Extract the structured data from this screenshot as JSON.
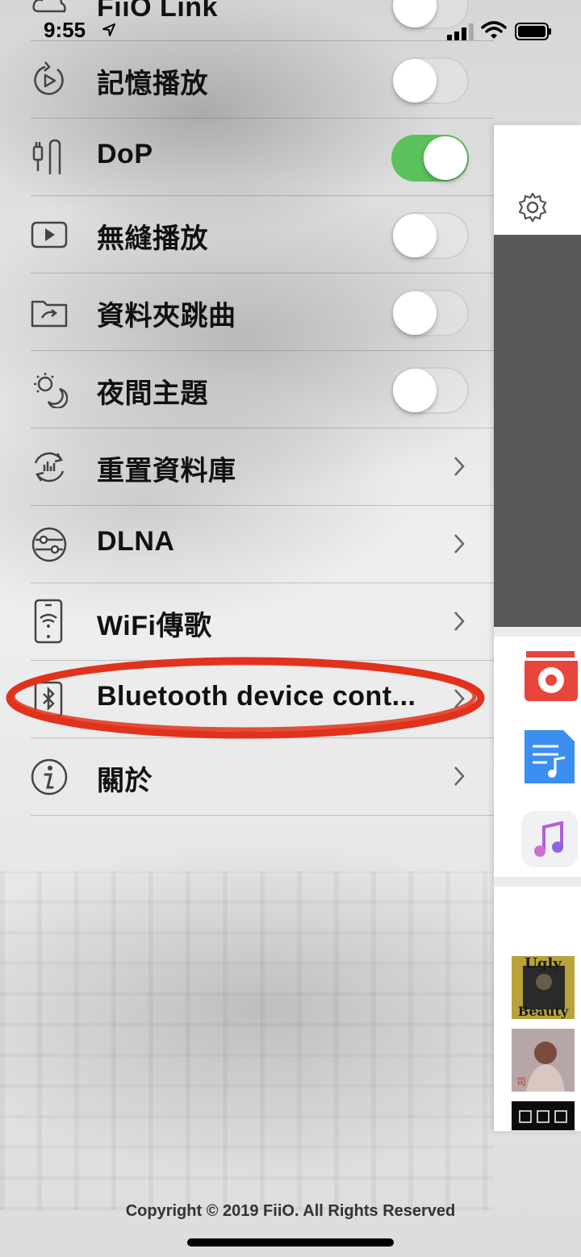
{
  "status_bar": {
    "time": "9:55"
  },
  "partial_row": {
    "label": "FiiO Link",
    "toggle": "off"
  },
  "settings": [
    {
      "label": "記憶播放",
      "control": "toggle",
      "state": "off",
      "icon": "resume-play-icon"
    },
    {
      "label": "DoP",
      "control": "toggle",
      "state": "on",
      "icon": "dop-cable-icon"
    },
    {
      "label": "無縫播放",
      "control": "toggle",
      "state": "off",
      "icon": "gapless-play-icon"
    },
    {
      "label": "資料夾跳曲",
      "control": "toggle",
      "state": "off",
      "icon": "folder-skip-icon"
    },
    {
      "label": "夜間主題",
      "control": "toggle",
      "state": "off",
      "icon": "night-theme-icon"
    },
    {
      "label": "重置資料庫",
      "control": "chevron",
      "icon": "reset-database-icon"
    },
    {
      "label": "DLNA",
      "control": "chevron",
      "icon": "dlna-icon"
    },
    {
      "label": "WiFi傳歌",
      "control": "chevron",
      "icon": "wifi-transfer-icon"
    },
    {
      "label": "Bluetooth device cont...",
      "control": "chevron",
      "icon": "bluetooth-icon",
      "highlighted": true
    },
    {
      "label": "關於",
      "control": "chevron",
      "icon": "info-icon"
    }
  ],
  "footer": {
    "copyright": "Copyright © 2019 FiiO. All Rights Reserved"
  },
  "side_panel": {
    "apps": [
      "fiio-music-app-icon",
      "music-file-app-icon",
      "apple-music-app-icon"
    ],
    "albums": [
      "Ugly Beauty",
      "album-cover-2",
      "album-cover-3"
    ]
  },
  "colors": {
    "toggle_on": "#5ac15b",
    "highlight_circle": "#e0321c",
    "panel_dark": "#58585a"
  }
}
